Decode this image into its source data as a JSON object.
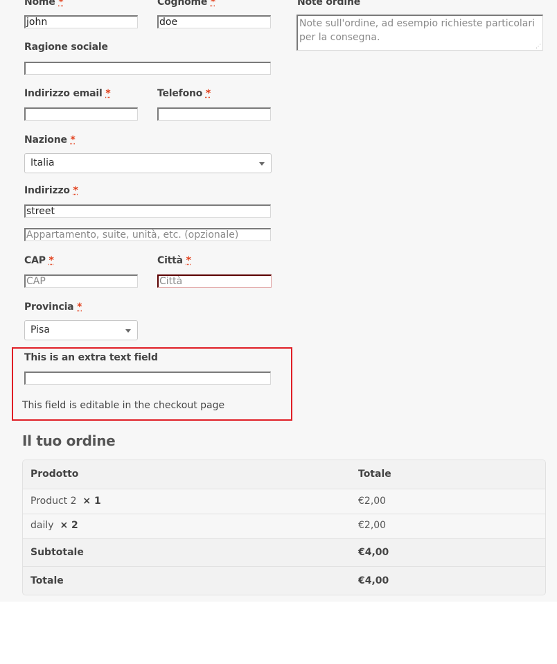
{
  "billing": {
    "first_name": {
      "label": "Nome",
      "required": "*",
      "value": "john"
    },
    "last_name": {
      "label": "Cognome",
      "required": "*",
      "value": "doe"
    },
    "company": {
      "label": "Ragione sociale",
      "value": ""
    },
    "email": {
      "label": "Indirizzo email",
      "required": "*",
      "value": ""
    },
    "phone": {
      "label": "Telefono",
      "required": "*",
      "value": ""
    },
    "country": {
      "label": "Nazione",
      "required": "*",
      "selected": "Italia"
    },
    "address": {
      "label": "Indirizzo",
      "required": "*",
      "value": "street",
      "address2_placeholder": "Appartamento, suite, unità, etc. (opzionale)"
    },
    "postcode": {
      "label": "CAP",
      "required": "*",
      "placeholder": "CAP"
    },
    "city": {
      "label": "Città",
      "required": "*",
      "placeholder": "Città"
    },
    "state": {
      "label": "Provincia",
      "required": "*",
      "selected": "Pisa"
    },
    "extra": {
      "label": "This is an extra text field",
      "value": "",
      "description": "This field is editable in the checkout page"
    }
  },
  "order_notes": {
    "label": "Note ordine",
    "placeholder": "Note sull'ordine, ad esempio richieste particolari per la consegna."
  },
  "order": {
    "title": "Il tuo ordine",
    "headers": {
      "product": "Prodotto",
      "total": "Totale"
    },
    "items": [
      {
        "name": "Product 2",
        "qty": "× 1",
        "total": "€2,00"
      },
      {
        "name": "daily",
        "qty": "× 2",
        "total": "€2,00"
      }
    ],
    "subtotal": {
      "label": "Subtotale",
      "value": "€4,00"
    },
    "total": {
      "label": "Totale",
      "value": "€4,00"
    }
  },
  "colors": {
    "required": "#e2401c",
    "highlight_border": "#e01f26",
    "error_border": "#5a0000"
  }
}
